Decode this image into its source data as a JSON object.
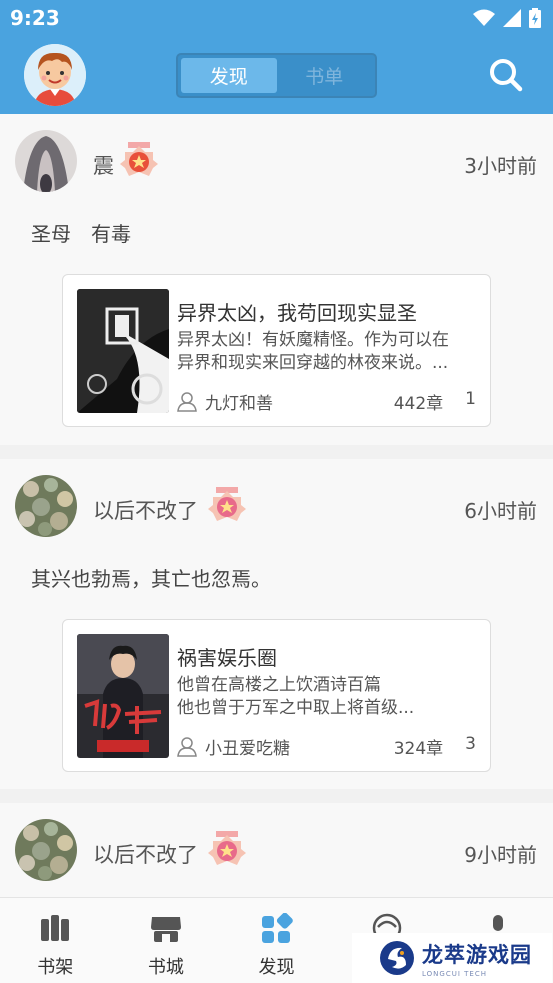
{
  "status_bar": {
    "time": "9:23"
  },
  "header": {
    "tabs": [
      {
        "label": "发现",
        "active": true
      },
      {
        "label": "书单",
        "active": false
      }
    ]
  },
  "colors": {
    "primary": "#4aa3df",
    "segment_bg": "#3a8fc9",
    "segment_active": "#6cb8ea"
  },
  "posts": [
    {
      "username": "震",
      "time": "3小时前",
      "text": "圣母　有毒",
      "book": {
        "title": "异界太凶，我苟回现实显圣",
        "desc_line1": "异界太凶！有妖魔精怪。作为可以在",
        "desc_line2": "异界和现实来回穿越的林夜来说。...",
        "author": "九灯和善",
        "chapters": "442章",
        "count": "1"
      }
    },
    {
      "username": "以后不改了",
      "time": "6小时前",
      "text": "其兴也勃焉，其亡也忽焉。",
      "book": {
        "title": "祸害娱乐圈",
        "desc_line1": "他曾在高楼之上饮酒诗百篇",
        "desc_line2": "他也曾于万军之中取上将首级...",
        "author": "小丑爱吃糖",
        "chapters": "324章",
        "count": "3"
      }
    },
    {
      "username": "以后不改了",
      "time": "9小时前"
    }
  ],
  "bottom_nav": [
    {
      "label": "书架",
      "icon": "bookshelf-icon"
    },
    {
      "label": "书城",
      "icon": "bookstore-icon"
    },
    {
      "label": "发现",
      "icon": "discover-icon",
      "active": true
    },
    {
      "label": "",
      "icon": "friends-icon"
    },
    {
      "label": "",
      "icon": "profile-icon"
    }
  ],
  "watermark": {
    "title": "龙萃游戏园",
    "subtitle": "LONGCUI TECH"
  }
}
